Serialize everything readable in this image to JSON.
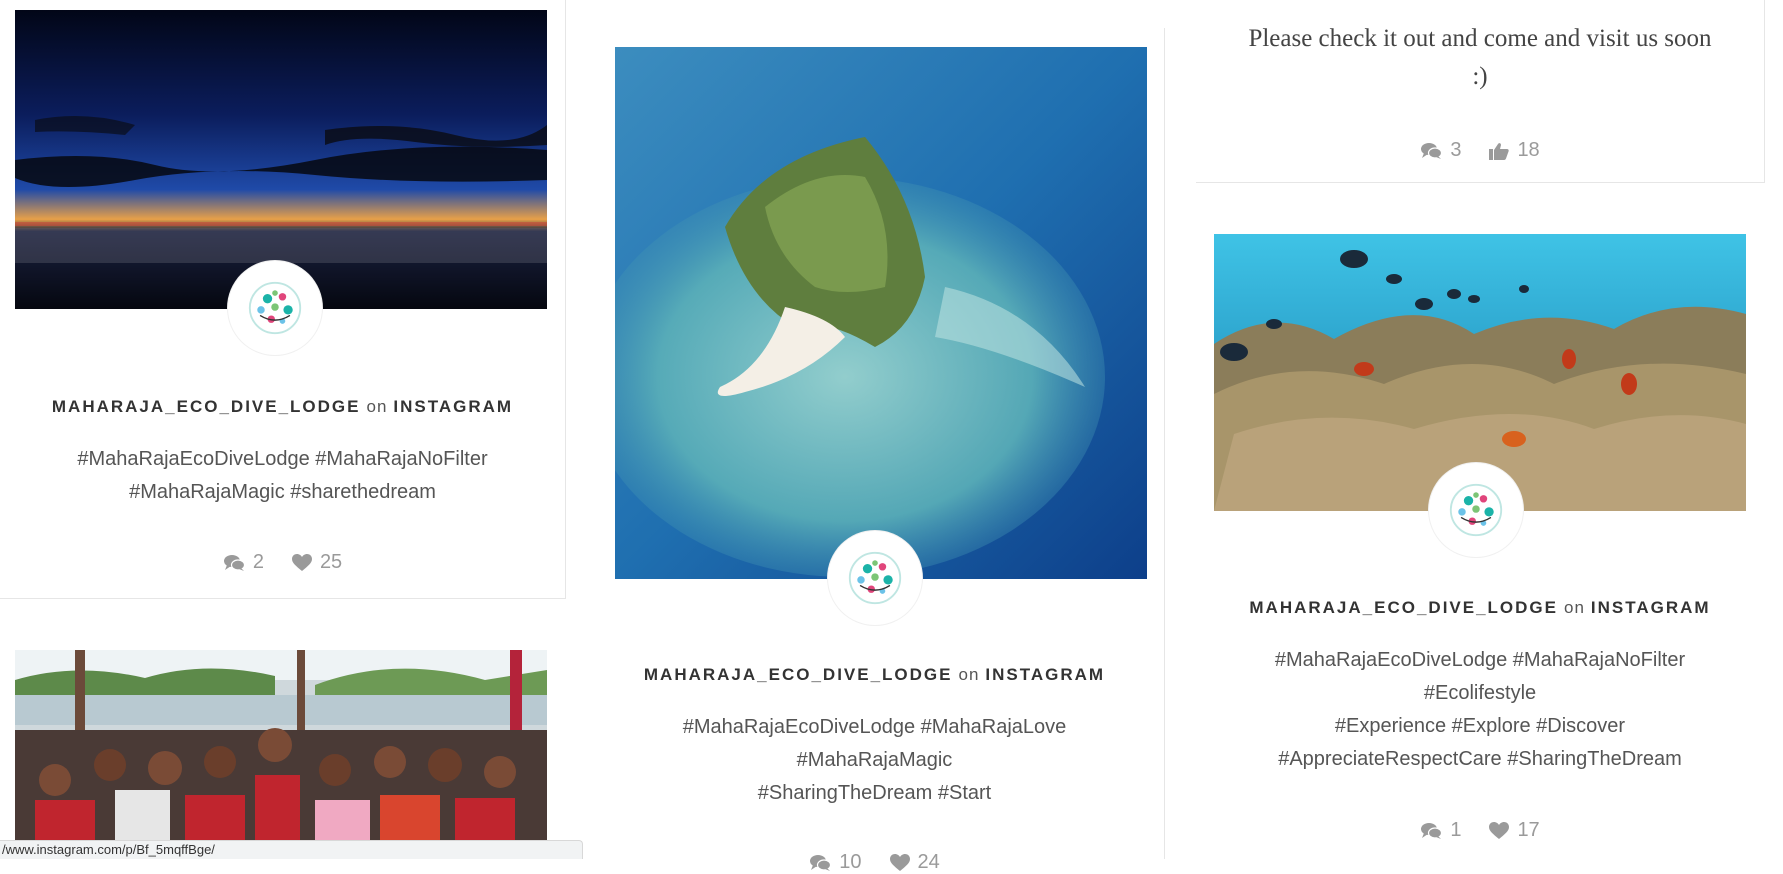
{
  "posts": [
    {
      "username": "MAHARAJA_ECO_DIVE_LODGE",
      "on_word": "on",
      "platform": "INSTAGRAM",
      "caption_lines": [
        "#MahaRajaEcoDiveLodge #MahaRajaNoFilter",
        "#MahaRajaMagic #sharethedream"
      ],
      "comments": "2",
      "likes": "25",
      "like_icon": "heart-icon"
    },
    {
      "username": "MAHARAJA_ECO_DIVE_LODGE",
      "on_word": "on",
      "platform": "INSTAGRAM",
      "caption_lines": [
        "#MahaRajaEcoDiveLodge #MahaRajaLove",
        "#MahaRajaMagic",
        "#SharingTheDream #Start"
      ],
      "comments": "10",
      "likes": "24",
      "like_icon": "heart-icon"
    },
    {
      "text_lines": [
        "Please check it out and come and visit us soon",
        ":)"
      ],
      "comments": "3",
      "likes": "18",
      "like_icon": "thumbs-up-icon"
    },
    {
      "username": "MAHARAJA_ECO_DIVE_LODGE",
      "on_word": "on",
      "platform": "INSTAGRAM",
      "caption_lines": [
        "#MahaRajaEcoDiveLodge #MahaRajaNoFilter",
        "#Ecolifestyle",
        "#Experience #Explore #Discover",
        "#AppreciateRespectCare #SharingTheDream"
      ],
      "comments": "1",
      "likes": "17",
      "like_icon": "heart-icon"
    }
  ],
  "status_url": "/www.instagram.com/p/Bf_5mqffBge/",
  "colors": {
    "text": "#555555",
    "stats": "#9a9a9a",
    "border": "#e6e6e6",
    "logo_teal": "#1bb3a8",
    "logo_pink": "#e0457b"
  }
}
